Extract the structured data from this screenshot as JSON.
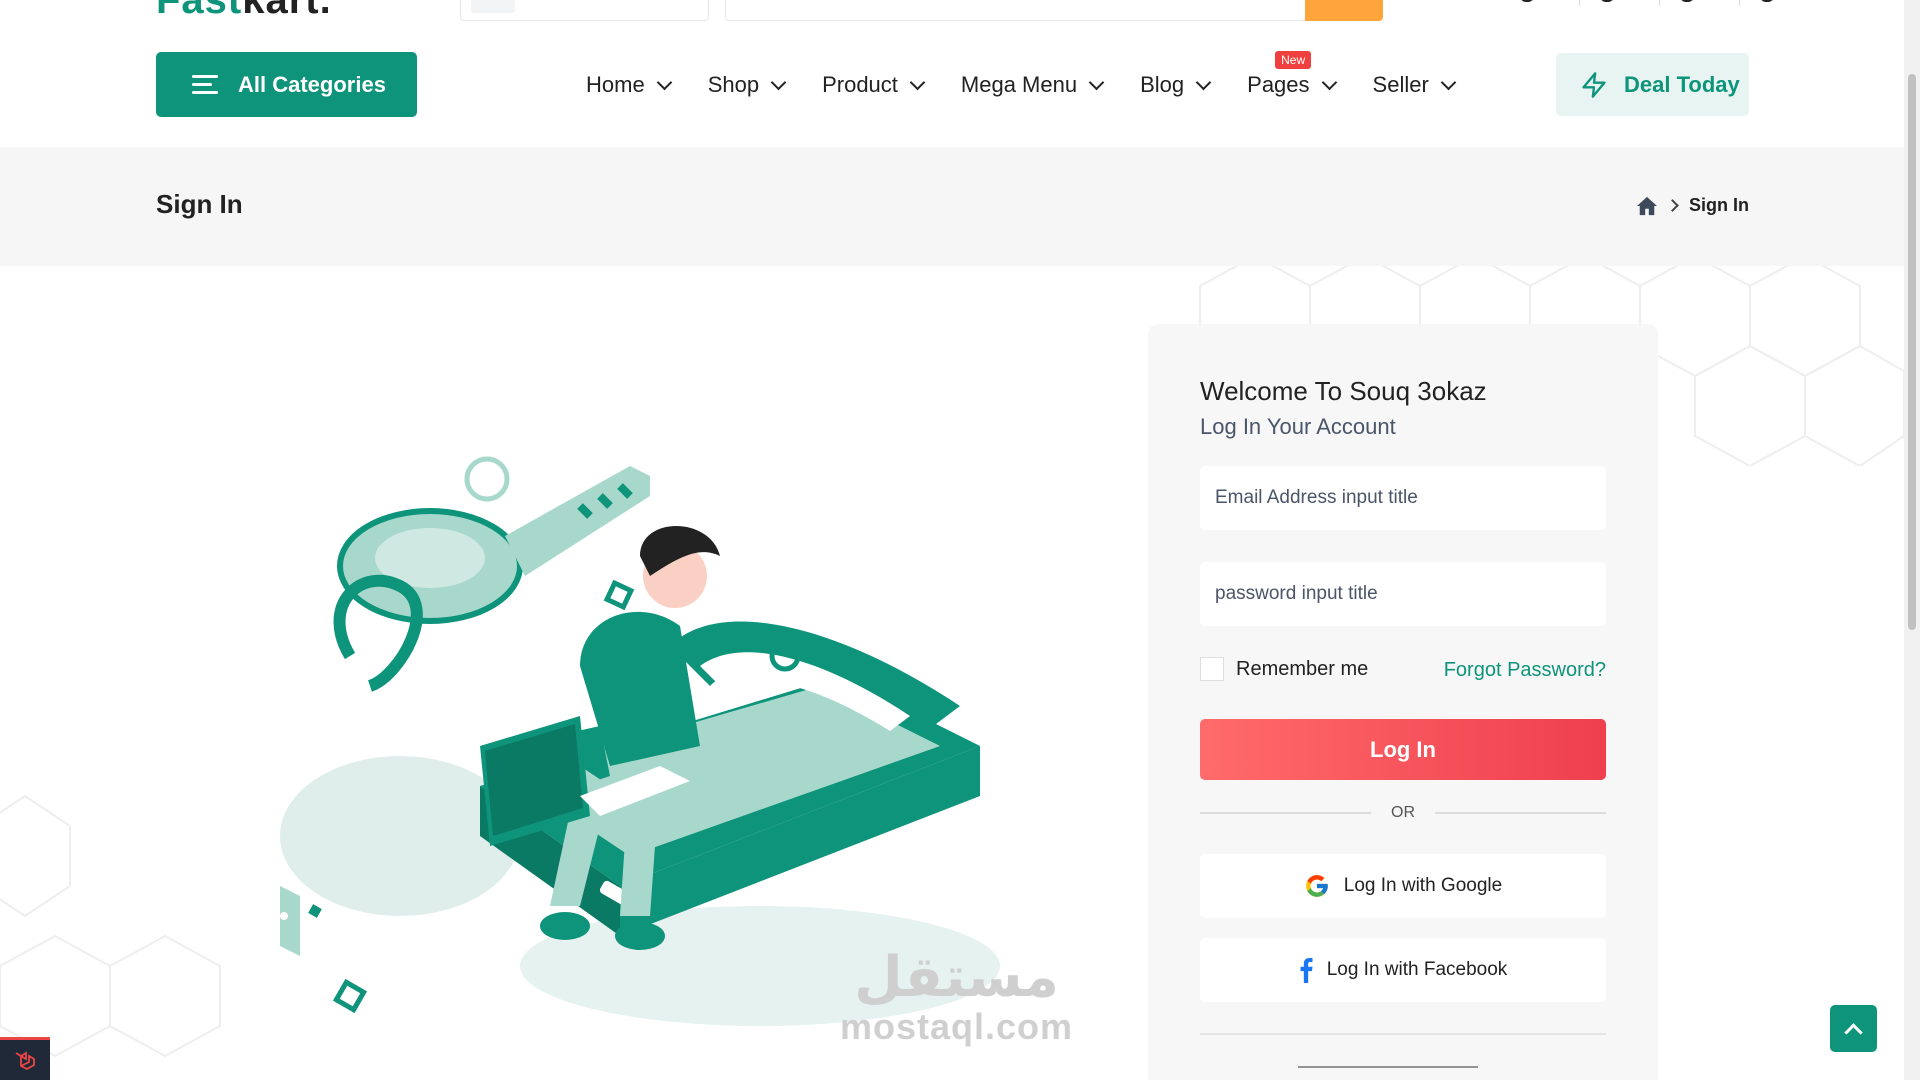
{
  "header": {
    "logo_prefix": "Fast",
    "logo_suffix": "kart."
  },
  "nav": {
    "all_categories": "All Categories",
    "items": [
      {
        "label": "Home"
      },
      {
        "label": "Shop"
      },
      {
        "label": "Product"
      },
      {
        "label": "Mega Menu"
      },
      {
        "label": "Blog"
      },
      {
        "label": "Pages",
        "badge": "New"
      },
      {
        "label": "Seller"
      }
    ],
    "deal_today": "Deal Today"
  },
  "breadcrumb": {
    "page_title": "Sign In",
    "current": "Sign In"
  },
  "login": {
    "welcome": "Welcome To Souq 3okaz",
    "subtitle": "Log In Your Account",
    "email_placeholder": "Email Address input title",
    "password_placeholder": "password input title",
    "remember_me": "Remember me",
    "forgot_password": "Forgot Password?",
    "login_button": "Log In",
    "or_text": "OR",
    "google_button": "Log In with Google",
    "facebook_button": "Log In with Facebook"
  },
  "watermark": {
    "arabic": "مستقل",
    "site": "mostaql.com"
  },
  "colors": {
    "brand": "#0e947a",
    "accent_orange": "#ffa53b",
    "login_red": "#ef3f4e",
    "badge_red": "#ef3f3e",
    "band_bg": "#f6f6f6"
  },
  "icons": [
    "menu-icon",
    "chevron-down-icon",
    "lightning-icon",
    "home-icon",
    "chevron-right-icon",
    "google-icon",
    "facebook-icon",
    "arrow-up-icon",
    "laravel-icon"
  ]
}
